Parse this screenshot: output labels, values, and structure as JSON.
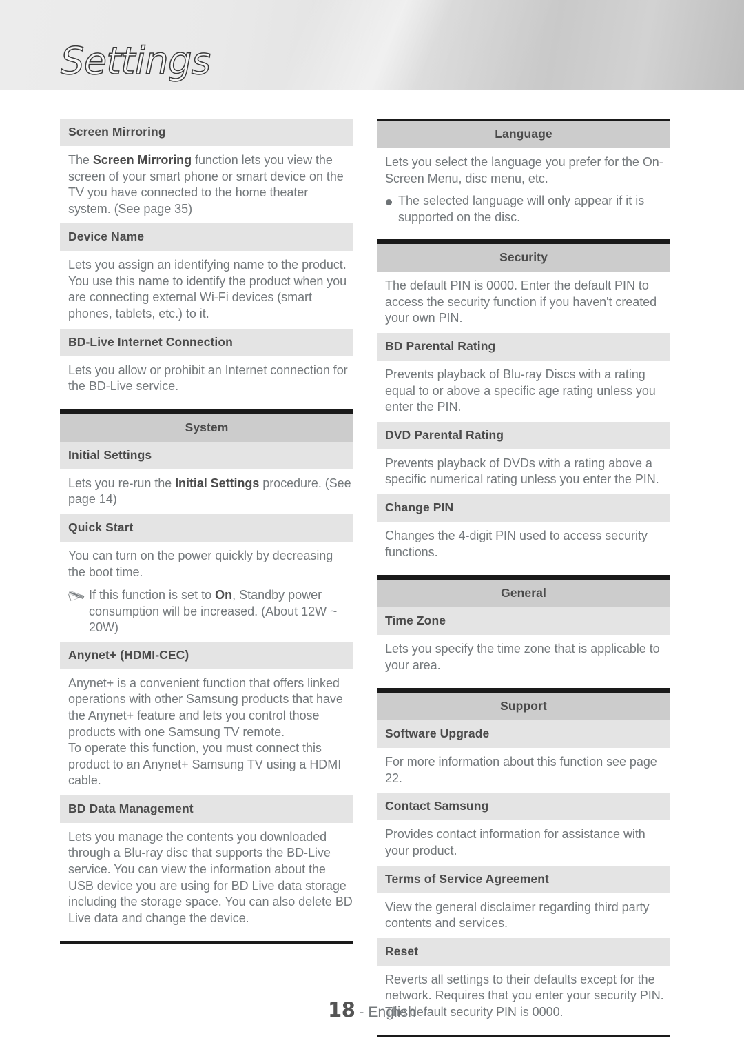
{
  "banner": {
    "title": "Settings"
  },
  "footer": {
    "page_number": "18",
    "separator": " - ",
    "language": "English"
  },
  "colors": {
    "section_head_bg": "#cccccc",
    "sub_head_bg": "#e4e4e4",
    "rule": "#1a1a1a",
    "heading_text": "#4b4b4b",
    "body_text": "#74797c"
  },
  "left_column": {
    "blocks": [
      {
        "kind": "sub-head",
        "name": "screen-mirroring",
        "label": "Screen Mirroring"
      },
      {
        "kind": "body",
        "name": "screen-mirroring-body",
        "runs": [
          {
            "text": "The ",
            "bold": false
          },
          {
            "text": "Screen Mirroring",
            "bold": true
          },
          {
            "text": " function lets you view the screen of your smart phone or smart device on the TV you have connected to the home theater system. (See page 35)",
            "bold": false
          }
        ]
      },
      {
        "kind": "sub-head",
        "name": "device-name",
        "label": "Device Name"
      },
      {
        "kind": "body",
        "name": "device-name-body",
        "runs": [
          {
            "text": "Lets you assign an identifying name to the product. You use this name to identify the product when you are connecting external Wi-Fi devices (smart phones, tablets, etc.) to it.",
            "bold": false
          }
        ]
      },
      {
        "kind": "sub-head",
        "name": "bd-live-internet-connection",
        "label": "BD-Live Internet Connection"
      },
      {
        "kind": "body",
        "name": "bd-live-internet-connection-body",
        "runs": [
          {
            "text": "Lets you allow or prohibit an Internet connection for the BD-Live service.",
            "bold": false
          }
        ]
      },
      {
        "kind": "rule",
        "name": "section-end-rule-network"
      },
      {
        "kind": "section-head",
        "name": "system",
        "label": "System"
      },
      {
        "kind": "sub-head",
        "name": "initial-settings",
        "label": "Initial Settings"
      },
      {
        "kind": "body",
        "name": "initial-settings-body",
        "runs": [
          {
            "text": "Lets you re-run the ",
            "bold": false
          },
          {
            "text": "Initial Settings",
            "bold": true
          },
          {
            "text": " procedure. (See page 14)",
            "bold": false
          }
        ]
      },
      {
        "kind": "sub-head",
        "name": "quick-start",
        "label": "Quick Start"
      },
      {
        "kind": "body",
        "name": "quick-start-body",
        "runs": [
          {
            "text": "You can turn on the power quickly by decreasing the boot time.",
            "bold": false
          }
        ]
      },
      {
        "kind": "note",
        "name": "quick-start-note",
        "icon": "pencil-note-icon",
        "runs": [
          {
            "text": "If this function is set to ",
            "bold": false
          },
          {
            "text": "On",
            "bold": true
          },
          {
            "text": ", Standby power consumption will be increased. (About 12W ~ 20W)",
            "bold": false
          }
        ]
      },
      {
        "kind": "sub-head",
        "name": "anynet-hdmi-cec",
        "label": "Anynet+ (HDMI-CEC)"
      },
      {
        "kind": "body",
        "name": "anynet-hdmi-cec-body",
        "runs": [
          {
            "text": "Anynet+ is a convenient function that offers linked operations with other Samsung products that have the Anynet+ feature and lets you control those products with one Samsung TV remote.\nTo operate this function, you must connect this product to an Anynet+ Samsung TV using a HDMI cable.",
            "bold": false
          }
        ]
      },
      {
        "kind": "sub-head",
        "name": "bd-data-management",
        "label": "BD Data Management"
      },
      {
        "kind": "body",
        "name": "bd-data-management-body",
        "runs": [
          {
            "text": "Lets you manage the contents you downloaded through a Blu-ray disc that supports the BD-Live service. You can view the information about the USB device you are using for BD Live data storage including the storage space. You can also delete BD Live data and change the device.",
            "bold": false
          }
        ]
      },
      {
        "kind": "rule",
        "name": "left-column-end-rule"
      }
    ]
  },
  "right_column": {
    "blocks": [
      {
        "kind": "section-head",
        "name": "language",
        "label": "Language"
      },
      {
        "kind": "body",
        "name": "language-body",
        "runs": [
          {
            "text": "Lets you select the language you prefer for the On-Screen Menu, disc menu, etc.",
            "bold": false
          }
        ]
      },
      {
        "kind": "bullet",
        "name": "language-bullet",
        "runs": [
          {
            "text": "The selected language will only appear if it is supported on the disc.",
            "bold": false
          }
        ]
      },
      {
        "kind": "rule",
        "name": "section-end-rule-language"
      },
      {
        "kind": "section-head",
        "name": "security",
        "label": "Security"
      },
      {
        "kind": "body",
        "name": "security-body",
        "runs": [
          {
            "text": "The default PIN is 0000. Enter the default PIN to access the security function if you haven't created your own PIN.",
            "bold": false
          }
        ]
      },
      {
        "kind": "sub-head",
        "name": "bd-parental-rating",
        "label": "BD Parental Rating"
      },
      {
        "kind": "body",
        "name": "bd-parental-rating-body",
        "runs": [
          {
            "text": "Prevents playback of Blu-ray Discs with a rating equal to or above a specific age rating unless you enter the PIN.",
            "bold": false
          }
        ]
      },
      {
        "kind": "sub-head",
        "name": "dvd-parental-rating",
        "label": "DVD Parental Rating"
      },
      {
        "kind": "body",
        "name": "dvd-parental-rating-body",
        "runs": [
          {
            "text": "Prevents playback of DVDs with a rating above a specific numerical rating unless you enter the PIN.",
            "bold": false
          }
        ]
      },
      {
        "kind": "sub-head",
        "name": "change-pin",
        "label": "Change PIN"
      },
      {
        "kind": "body",
        "name": "change-pin-body",
        "runs": [
          {
            "text": "Changes the 4-digit PIN used to access security functions.",
            "bold": false
          }
        ]
      },
      {
        "kind": "rule",
        "name": "section-end-rule-security"
      },
      {
        "kind": "section-head",
        "name": "general",
        "label": "General"
      },
      {
        "kind": "sub-head",
        "name": "time-zone",
        "label": "Time Zone"
      },
      {
        "kind": "body",
        "name": "time-zone-body",
        "runs": [
          {
            "text": "Lets you specify the time zone that is applicable to your area.",
            "bold": false
          }
        ]
      },
      {
        "kind": "rule",
        "name": "section-end-rule-general"
      },
      {
        "kind": "section-head",
        "name": "support",
        "label": "Support"
      },
      {
        "kind": "sub-head",
        "name": "software-upgrade",
        "label": "Software Upgrade"
      },
      {
        "kind": "body",
        "name": "software-upgrade-body",
        "runs": [
          {
            "text": "For more information about this function see page 22.",
            "bold": false
          }
        ]
      },
      {
        "kind": "sub-head",
        "name": "contact-samsung",
        "label": "Contact Samsung"
      },
      {
        "kind": "body",
        "name": "contact-samsung-body",
        "runs": [
          {
            "text": "Provides contact information for assistance with your product.",
            "bold": false
          }
        ]
      },
      {
        "kind": "sub-head",
        "name": "terms-of-service-agreement",
        "label": "Terms of Service Agreement"
      },
      {
        "kind": "body",
        "name": "terms-of-service-agreement-body",
        "runs": [
          {
            "text": "View the general disclaimer regarding third party contents and services.",
            "bold": false
          }
        ]
      },
      {
        "kind": "sub-head",
        "name": "reset",
        "label": "Reset"
      },
      {
        "kind": "body",
        "name": "reset-body",
        "runs": [
          {
            "text": "Reverts all settings to their defaults except for the network. Requires that you enter your security PIN. The default security PIN is 0000.",
            "bold": false
          }
        ]
      },
      {
        "kind": "rule",
        "name": "right-column-end-rule"
      }
    ]
  }
}
